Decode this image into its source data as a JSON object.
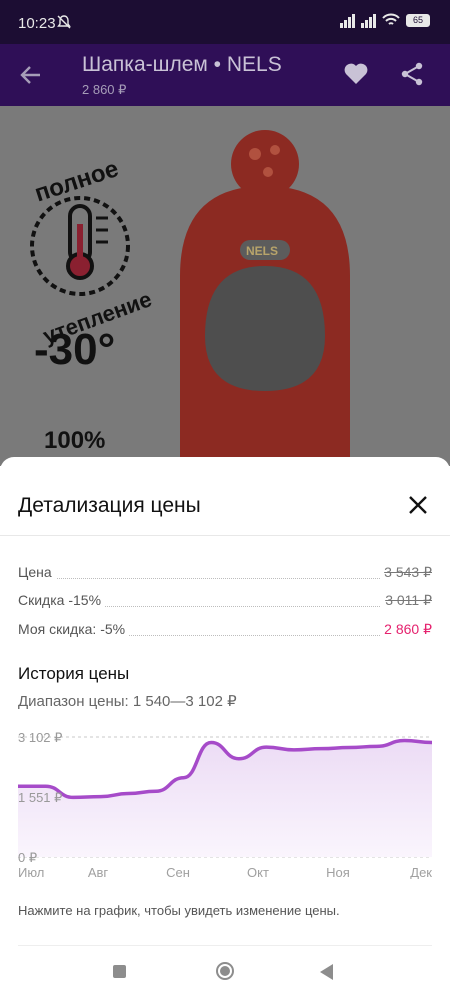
{
  "status_bar": {
    "time": "10:23",
    "battery": "65"
  },
  "header": {
    "title": "Шапка-шлем • NELS",
    "price": "2 860 ₽"
  },
  "hero": {
    "badge_line1": "полное",
    "badge_line2": "утепление",
    "temperature": "-30°",
    "percent": "100%",
    "brand_tag": "NELS"
  },
  "sheet": {
    "title": "Детализация цены",
    "rows": [
      {
        "label": "Цена",
        "value": "3 543 ₽"
      },
      {
        "label": "Скидка -15%",
        "value": "3 011 ₽"
      },
      {
        "label": "Моя скидка: -5%",
        "value": "2 860 ₽"
      }
    ],
    "history_title": "История цены",
    "range_text": "Диапазон цены: 1 540—3 102 ₽",
    "hint": "Нажмите на график, чтобы увидеть изменение цены."
  },
  "colors": {
    "accent": "#e5226e",
    "brand": "#2f0f57",
    "line": "#a64bc9"
  },
  "chart_data": {
    "type": "area",
    "x_ticks": [
      "Июл",
      "Авг",
      "Сен",
      "Окт",
      "Ноя",
      "Дек"
    ],
    "y_ticks": [
      "3 102 ₽",
      "1 551 ₽",
      "0 ₽"
    ],
    "ylim": [
      0,
      3102
    ],
    "series": [
      {
        "values": [
          [
            "Июл",
            1830
          ],
          [
            "Июл",
            1830
          ],
          [
            "Авг",
            1540
          ],
          [
            "Авг",
            1560
          ],
          [
            "Авг",
            1640
          ],
          [
            "Сен",
            1700
          ],
          [
            "Сен",
            2050
          ],
          [
            "Сен",
            2960
          ],
          [
            "Сен",
            2540
          ],
          [
            "Окт",
            2840
          ],
          [
            "Окт",
            2770
          ],
          [
            "Ноя",
            2800
          ],
          [
            "Ноя",
            2830
          ],
          [
            "Дек",
            2860
          ],
          [
            "Дек",
            3010
          ],
          [
            "Дек",
            2960
          ]
        ]
      }
    ]
  }
}
